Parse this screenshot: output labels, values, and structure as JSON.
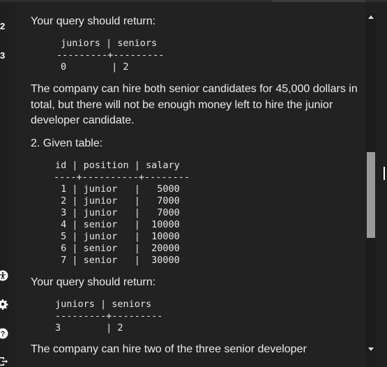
{
  "rail": {
    "item_a": "2",
    "item_b": "3"
  },
  "text": {
    "query_return_1": "Your query should return:",
    "explanation_1_l1": "The company can hire both senior candidates for 45,000 dollars in",
    "explanation_1_l2": "total, but there will not be enough money left to hire the junior",
    "explanation_1_l3": "developer candidate.",
    "given_table": "2. Given table:",
    "query_return_2": "Your query should return:",
    "explanation_2_l1": "The company can hire two of the three senior developer"
  },
  "result1": {
    "header": "juniors | seniors",
    "sep": "---------+---------",
    "row": "0        | 2"
  },
  "table": {
    "header": "id | position | salary",
    "sep": "----+----------+--------",
    "rows": [
      " 1 | junior   |   5000",
      " 2 | junior   |   7000",
      " 3 | junior   |   7000",
      " 4 | senior   |  10000",
      " 5 | junior   |  10000",
      " 6 | senior   |  20000",
      " 7 | senior   |  30000"
    ]
  },
  "result2": {
    "header": "juniors | seniors",
    "sep": "---------+---------",
    "row": "3        | 2"
  },
  "colors": {
    "background": "#222222",
    "text": "#ececec",
    "scrollbar_thumb": "#9a9a9a"
  },
  "icons": [
    "accessibility-icon",
    "gear-icon",
    "help-icon",
    "exit-icon"
  ]
}
